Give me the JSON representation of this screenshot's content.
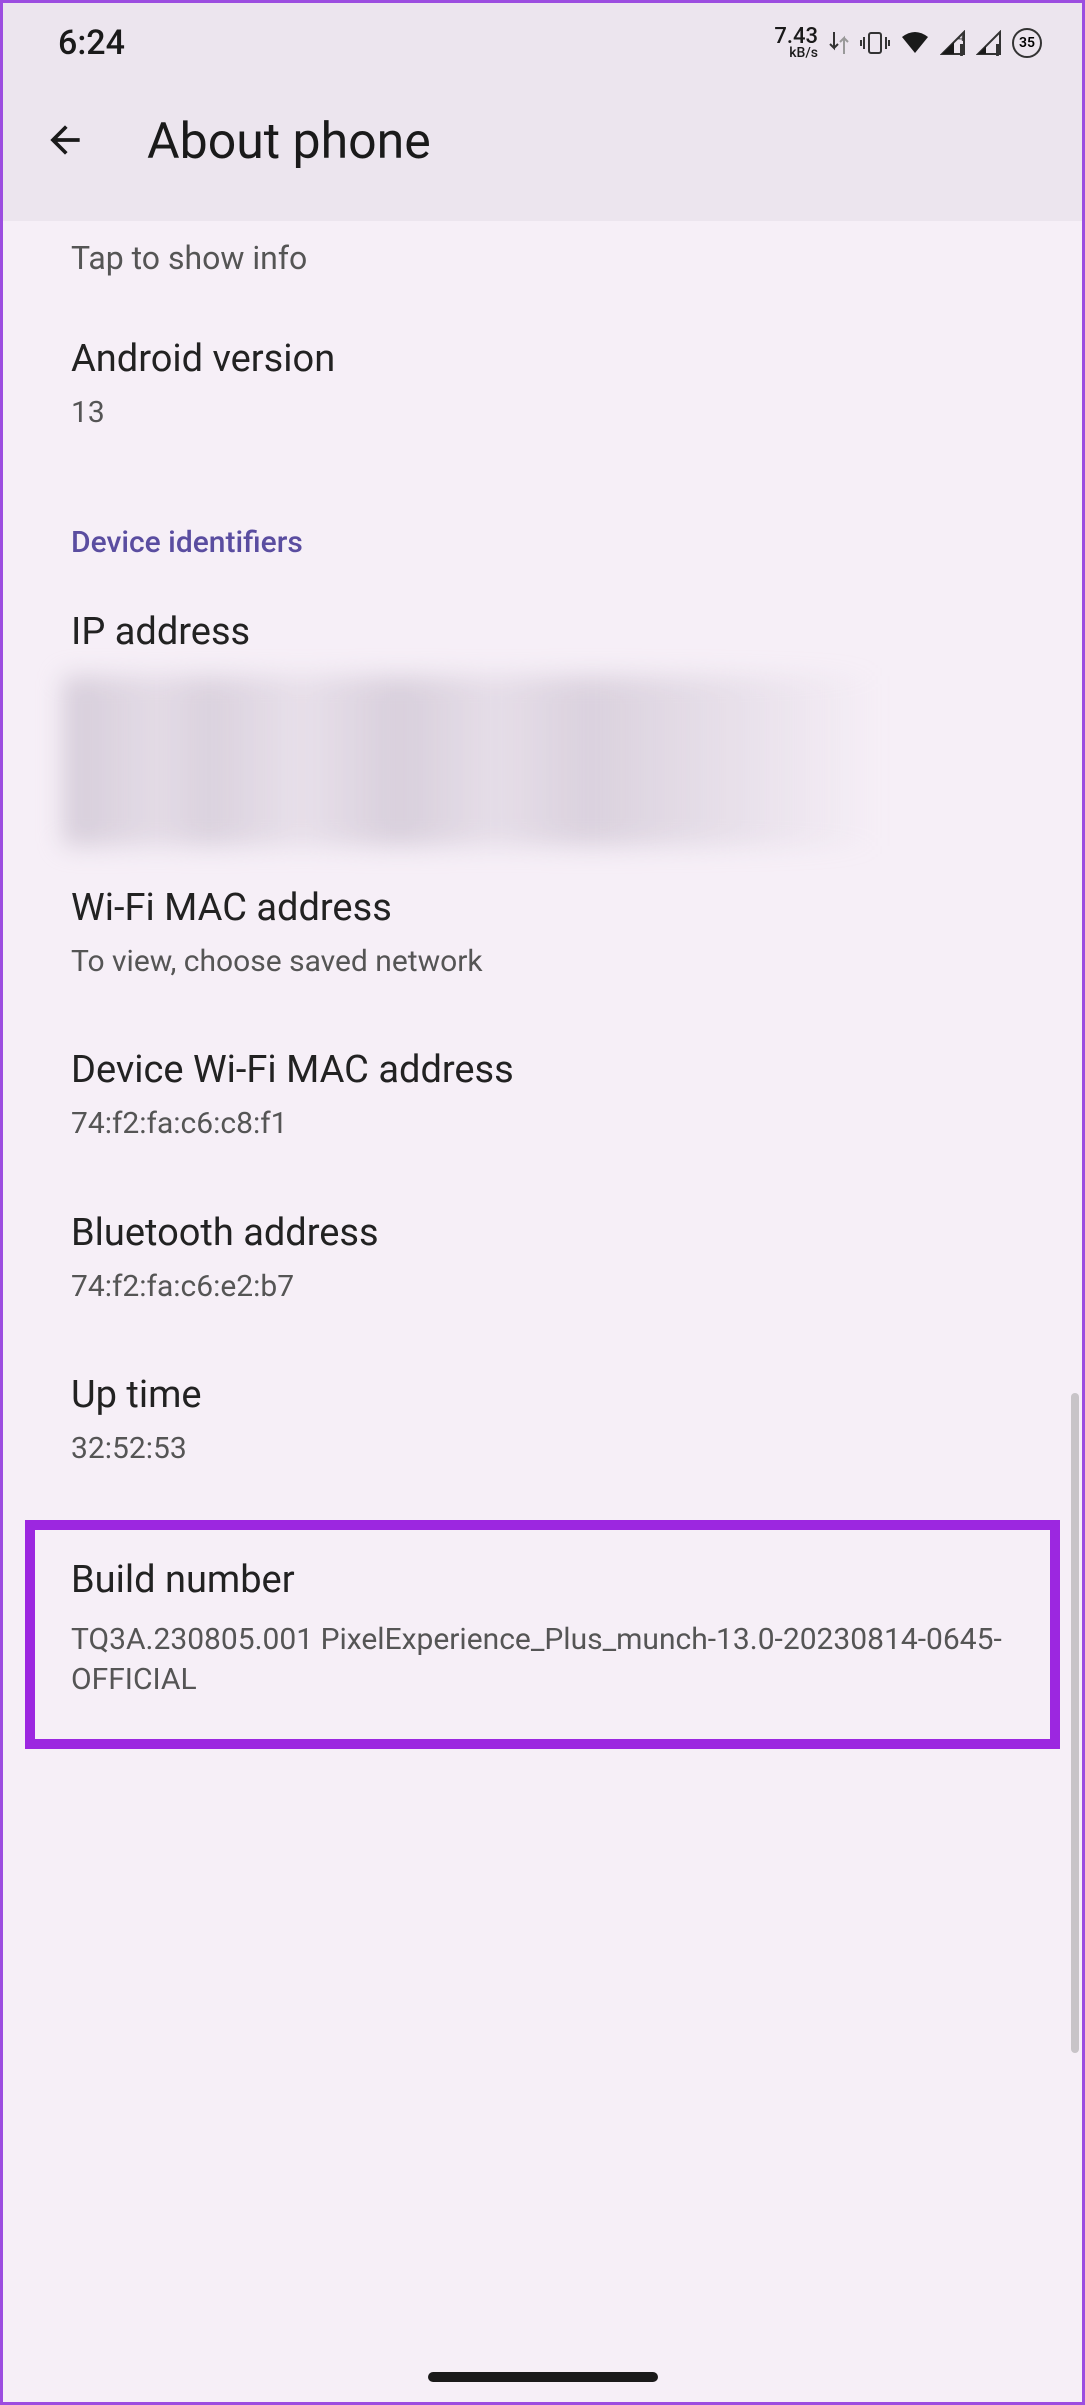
{
  "status_bar": {
    "time": "6:24",
    "speed": "7.43",
    "speed_unit": "kB/s",
    "battery": "35"
  },
  "header": {
    "title": "About phone"
  },
  "tap_info": "Tap to show info",
  "items": {
    "android_version": {
      "title": "Android version",
      "value": "13"
    },
    "section_identifiers": "Device identifiers",
    "ip_address": {
      "title": "IP address"
    },
    "wifi_mac": {
      "title": "Wi-Fi MAC address",
      "value": "To view, choose saved network"
    },
    "device_wifi_mac": {
      "title": "Device Wi-Fi MAC address",
      "value": "74:f2:fa:c6:c8:f1"
    },
    "bluetooth": {
      "title": "Bluetooth address",
      "value": "74:f2:fa:c6:e2:b7"
    },
    "uptime": {
      "title": "Up time",
      "value": "32:52:53"
    },
    "build": {
      "title": "Build number",
      "value": "TQ3A.230805.001 PixelExperience_Plus_munch-13.0-20230814-0645-OFFICIAL"
    }
  }
}
